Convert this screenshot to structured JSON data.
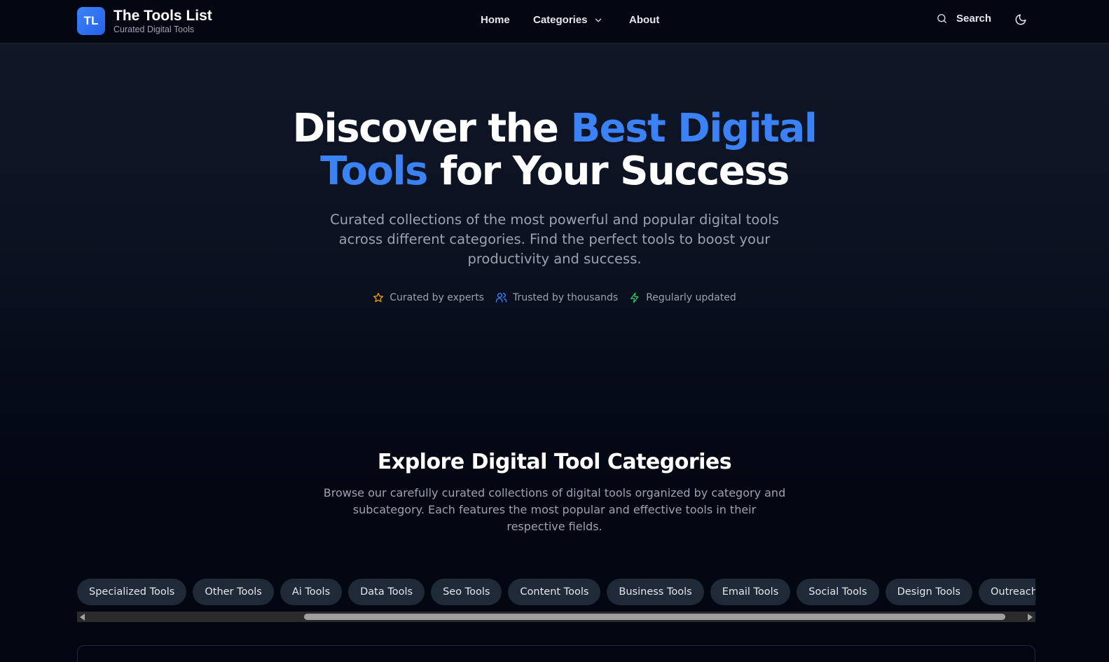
{
  "header": {
    "logo_initials": "TL",
    "brand_title": "The Tools List",
    "brand_subtitle": "Curated Digital Tools",
    "nav": {
      "home": "Home",
      "categories": "Categories",
      "about": "About"
    },
    "search_label": "Search"
  },
  "hero": {
    "title_part1": "Discover the ",
    "title_accent1": "Best Digital",
    "title_accent2": "Tools",
    "title_part2": " for Your Success",
    "description": "Curated collections of the most powerful and popular digital tools across different categories. Find the perfect tools to boost your productivity and success.",
    "features": [
      {
        "label": "Curated by experts",
        "icon": "star-icon",
        "color": "#f59e0b"
      },
      {
        "label": "Trusted by thousands",
        "icon": "users-icon",
        "color": "#3b82f6"
      },
      {
        "label": "Regularly updated",
        "icon": "zap-icon",
        "color": "#22c55e"
      }
    ]
  },
  "categories_section": {
    "title": "Explore Digital Tool Categories",
    "description": "Browse our carefully curated collections of digital tools organized by category and subcategory. Each features the most popular and effective tools in their respective fields.",
    "pills": [
      "Specialized Tools",
      "Other Tools",
      "Ai Tools",
      "Data Tools",
      "Seo Tools",
      "Content Tools",
      "Business Tools",
      "Email Tools",
      "Social Tools",
      "Design Tools",
      "Outreach Tools"
    ]
  },
  "colors": {
    "accent": "#3b82f6",
    "background": "#030712",
    "pill_bg": "#1f2937"
  }
}
